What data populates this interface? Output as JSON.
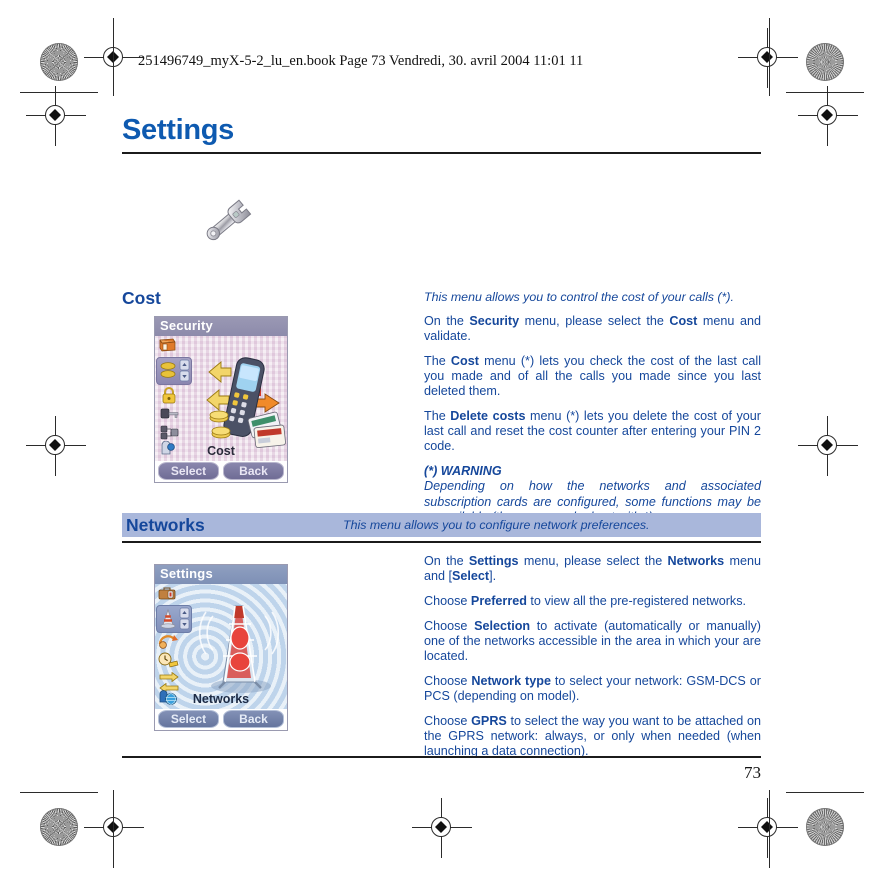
{
  "print": {
    "header_line": "251496749_myX-5-2_lu_en.book  Page 73  Vendredi, 30. avril 2004  11:01 11",
    "page_number": "73",
    "registration_mark": "registration-target",
    "rosette_mark": "color-rosette"
  },
  "document": {
    "title": "Settings",
    "chapter_icon": "wrench-icon",
    "accent_color": "#15479b",
    "title_color": "#0e5ab0",
    "band_color": "#a9b7db"
  },
  "sections": [
    {
      "heading": "Cost",
      "intro": "This menu allows you to control the cost of your calls (*).",
      "screenshot": {
        "title": "Security",
        "caption": "Cost",
        "softkeys": [
          "Select",
          "Back"
        ],
        "illustration": "phone-coins-cards-icon"
      },
      "paragraphs": [
        [
          {
            "t": "On the ",
            "b": false
          },
          {
            "t": "Security",
            "b": true
          },
          {
            "t": " menu, please select the ",
            "b": false
          },
          {
            "t": "Cost",
            "b": true
          },
          {
            "t": " menu and validate.",
            "b": false
          }
        ],
        [
          {
            "t": "The ",
            "b": false
          },
          {
            "t": "Cost",
            "b": true
          },
          {
            "t": " menu (*) lets you check the cost of the last call you made and of all the calls you made since you last deleted them.",
            "b": false
          }
        ],
        [
          {
            "t": "The ",
            "b": false
          },
          {
            "t": "Delete costs",
            "b": true
          },
          {
            "t": " menu (*) lets you delete the cost of your last call and reset the cost counter after entering your PIN 2 code.",
            "b": false
          }
        ]
      ],
      "warning_title": "(*) WARNING",
      "warning_body": "Depending on how the networks and associated subscription cards are configured, some functions may be unavailable (these are marked out with *)."
    },
    {
      "heading": "Networks",
      "intro": "This menu allows you to configure network preferences.",
      "screenshot": {
        "title": "Settings",
        "caption": "Networks",
        "softkeys": [
          "Select",
          "Back"
        ],
        "illustration": "antenna-tower-icon"
      },
      "paragraphs": [
        [
          {
            "t": "On the ",
            "b": false
          },
          {
            "t": "Settings",
            "b": true
          },
          {
            "t": " menu, please select the ",
            "b": false
          },
          {
            "t": "Networks",
            "b": true
          },
          {
            "t": " menu and [",
            "b": false
          },
          {
            "t": "Select",
            "b": true
          },
          {
            "t": "].",
            "b": false
          }
        ],
        [
          {
            "t": "Choose ",
            "b": false
          },
          {
            "t": "Preferred",
            "b": true
          },
          {
            "t": " to view all the pre-registered networks.",
            "b": false
          }
        ],
        [
          {
            "t": "Choose ",
            "b": false
          },
          {
            "t": "Selection",
            "b": true
          },
          {
            "t": " to activate (automatically or manually) one of the networks accessible in the area in which your are located.",
            "b": false
          }
        ],
        [
          {
            "t": "Choose ",
            "b": false
          },
          {
            "t": "Network type",
            "b": true
          },
          {
            "t": " to select your network: GSM-DCS or PCS (depending on model).",
            "b": false
          }
        ],
        [
          {
            "t": "Choose ",
            "b": false
          },
          {
            "t": "GPRS",
            "b": true
          },
          {
            "t": " to select the way you want to be attached on the GPRS network: always, or only when needed (when launching a data connection).",
            "b": false
          }
        ]
      ]
    }
  ]
}
